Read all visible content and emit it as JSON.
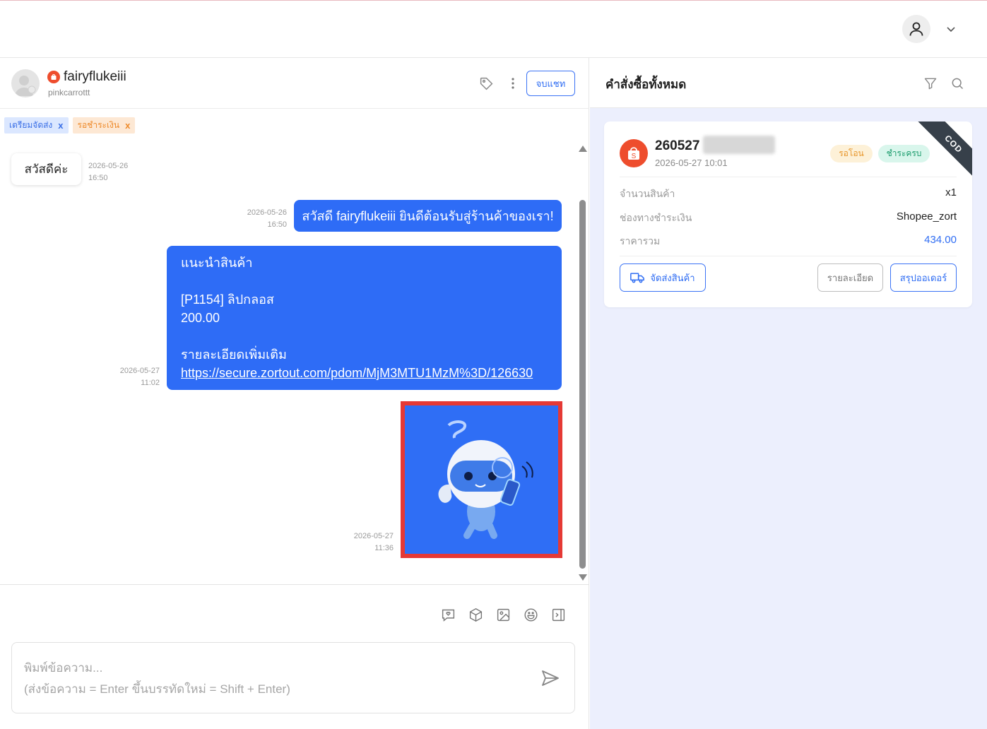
{
  "header": {
    "profile_icon": "user-icon",
    "dropdown_icon": "chevron-down-icon"
  },
  "chat": {
    "customer": {
      "name": "fairyflukeiii",
      "username": "pinkcarrottt",
      "platform_icon": "shopee-icon"
    },
    "end_chat_label": "จบแชท",
    "tags": [
      {
        "label": "เตรียมจัดส่ง",
        "remove": "x"
      },
      {
        "label": "รอชำระเงิน",
        "remove": "x"
      }
    ],
    "messages": [
      {
        "direction": "in",
        "text": "สวัสดีค่ะ",
        "date": "2026-05-26",
        "time": "16:50"
      },
      {
        "direction": "out",
        "text": "สวัสดี fairyflukeiii ยินดีต้อนรับสู่ร้านค้าของเรา!",
        "date": "2026-05-26",
        "time": "16:50"
      },
      {
        "direction": "out",
        "title": "แนะนำสินค้า",
        "product": "[P1154] ลิปกลอส",
        "price": "200.00",
        "more_label": "รายละเอียดเพิ่มเติม",
        "link": "https://secure.zortout.com/pdom/MjM3MTU1MzM%3D/126630",
        "date": "2026-05-27",
        "time": "11:02"
      },
      {
        "direction": "out",
        "type": "image",
        "image": "robot-mascot-image",
        "date": "2026-05-27",
        "time": "11:36"
      }
    ],
    "composer": {
      "placeholder_line1": "พิมพ์ข้อความ...",
      "placeholder_line2": "(ส่งข้อความ = Enter ขึ้นบรรทัดใหม่ = Shift + Enter)",
      "tools": [
        "quick-reply-icon",
        "product-box-icon",
        "image-icon",
        "emoji-icon",
        "panel-toggle-icon"
      ]
    }
  },
  "orders": {
    "title": "คำสั่งซื้อทั้งหมด",
    "cards": [
      {
        "order_no": "260527",
        "date": "2026-05-27 10:01",
        "status_transfer": "รอโอน",
        "status_paid": "ชำระครบ",
        "ribbon": "COD",
        "rows": [
          {
            "label": "จำนวนสินค้า",
            "value": "x1"
          },
          {
            "label": "ช่องทางชำระเงิน",
            "value": "Shopee_zort"
          },
          {
            "label": "ราคารวม",
            "value": "434.00"
          }
        ],
        "ship_label": "จัดส่งสินค้า",
        "detail_label": "รายละเอียด",
        "summary_label": "สรุปออเดอร์"
      }
    ]
  },
  "colors": {
    "primary": "#2e6cf6",
    "shopee": "#ee4d2d",
    "panel_bg": "#eceffd"
  }
}
